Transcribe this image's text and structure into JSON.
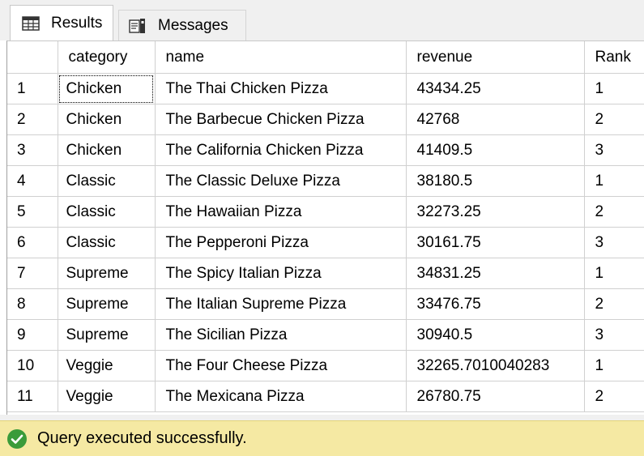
{
  "tabs": {
    "results_label": "Results",
    "messages_label": "Messages"
  },
  "grid": {
    "columns": [
      "",
      "category",
      "name",
      "revenue",
      "Rank"
    ],
    "rows": [
      {
        "num": "1",
        "category": "Chicken",
        "name": "The Thai Chicken Pizza",
        "revenue": "43434.25",
        "rank": "1"
      },
      {
        "num": "2",
        "category": "Chicken",
        "name": "The Barbecue Chicken Pizza",
        "revenue": "42768",
        "rank": "2"
      },
      {
        "num": "3",
        "category": "Chicken",
        "name": "The California Chicken Pizza",
        "revenue": "41409.5",
        "rank": "3"
      },
      {
        "num": "4",
        "category": "Classic",
        "name": "The Classic Deluxe Pizza",
        "revenue": "38180.5",
        "rank": "1"
      },
      {
        "num": "5",
        "category": "Classic",
        "name": "The Hawaiian Pizza",
        "revenue": "32273.25",
        "rank": "2"
      },
      {
        "num": "6",
        "category": "Classic",
        "name": "The Pepperoni Pizza",
        "revenue": "30161.75",
        "rank": "3"
      },
      {
        "num": "7",
        "category": "Supreme",
        "name": "The Spicy Italian Pizza",
        "revenue": "34831.25",
        "rank": "1"
      },
      {
        "num": "8",
        "category": "Supreme",
        "name": "The Italian Supreme Pizza",
        "revenue": "33476.75",
        "rank": "2"
      },
      {
        "num": "9",
        "category": "Supreme",
        "name": "The Sicilian Pizza",
        "revenue": "30940.5",
        "rank": "3"
      },
      {
        "num": "10",
        "category": "Veggie",
        "name": "The Four Cheese Pizza",
        "revenue": "32265.7010040283",
        "rank": "1"
      },
      {
        "num": "11",
        "category": "Veggie",
        "name": "The Mexicana Pizza",
        "revenue": "26780.75",
        "rank": "2"
      }
    ]
  },
  "status": {
    "message": "Query executed successfully.",
    "icon": "success-check-icon",
    "background_color": "#f5e9a3",
    "icon_color": "#3a9b3a"
  }
}
